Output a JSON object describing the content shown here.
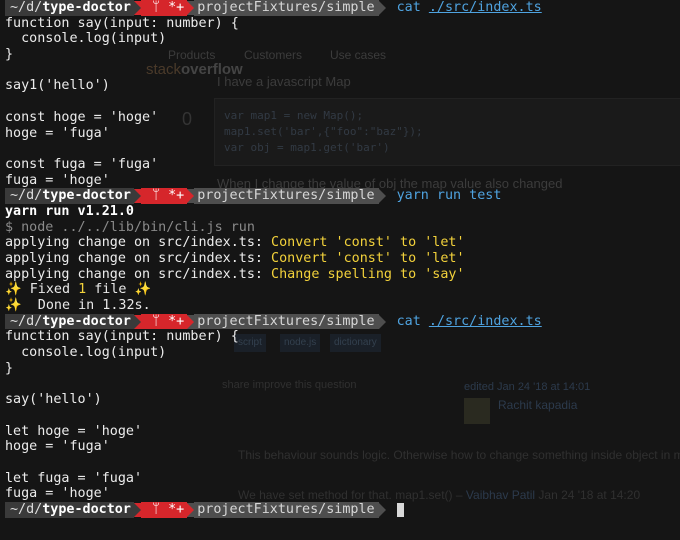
{
  "prompt": {
    "path_prefix": "~/d/",
    "repo": "type-doctor",
    "git_status": " ᛘ *+",
    "subdir": "projectFixtures/simple"
  },
  "blocks": [
    {
      "command": "cat",
      "argument": "./src/index.ts",
      "output": [
        "function say(input: number) {",
        "  console.log(input)",
        "}",
        "",
        "say1('hello')",
        "",
        "const hoge = 'hoge'",
        "hoge = 'fuga'",
        "",
        "const fuga = 'fuga'",
        "fuga = 'hoge'"
      ]
    },
    {
      "command": "yarn run test",
      "argument": "",
      "output_rich": {
        "yarn_version": "yarn run v1.21.0",
        "node_cmd": "$ node ../../lib/bin/cli.js run",
        "changes": [
          {
            "prefix": "applying change on src/index.ts: ",
            "action": "Convert 'const' to 'let'"
          },
          {
            "prefix": "applying change on src/index.ts: ",
            "action": "Convert 'const' to 'let'"
          },
          {
            "prefix": "applying change on src/index.ts: ",
            "action": "Change spelling to 'say'"
          }
        ],
        "fixed_pre": "✨ Fixed ",
        "fixed_count": "1",
        "fixed_post": " file ✨",
        "done": "✨  Done in 1.32s."
      }
    },
    {
      "command": "cat",
      "argument": "./src/index.ts",
      "output": [
        "function say(input: number) {",
        "  console.log(input)",
        "}",
        "",
        "say('hello')",
        "",
        "let hoge = 'hoge'",
        "hoge = 'fuga'",
        "",
        "let fuga = 'fuga'",
        "fuga = 'hoge'"
      ]
    }
  ],
  "background": {
    "logo_left": "stack",
    "logo_right": "overflow",
    "nav": [
      "Products",
      "Customers",
      "Use cases"
    ],
    "question_intro": "I have a javascript Map",
    "code_lines": [
      "var map1 = new Map();",
      "map1.set('bar',{\"foo\":\"baz\"});",
      "var obj = map1.get('bar')"
    ],
    "vote_count": "0",
    "changed_text": "When I change the value of obj the map value also changed",
    "tags": [
      "script",
      "node.js",
      "dictionary"
    ],
    "share_line": "share  improve this question",
    "edited": "edited Jan 24 '18 at 14:01",
    "user": "Rachit kapadia",
    "comment": "This behaviour sounds logic. Otherwise how to change something inside object in map?",
    "comment2": "We have set method for that. map1.set() –",
    "commenter": "Vaibhav Patil",
    "comment2_time": "Jan 24 '18 at 14:20"
  },
  "colors": {
    "git_segment": "#d6262b",
    "command": "#4fa3e0",
    "highlight": "#f3d23b"
  }
}
